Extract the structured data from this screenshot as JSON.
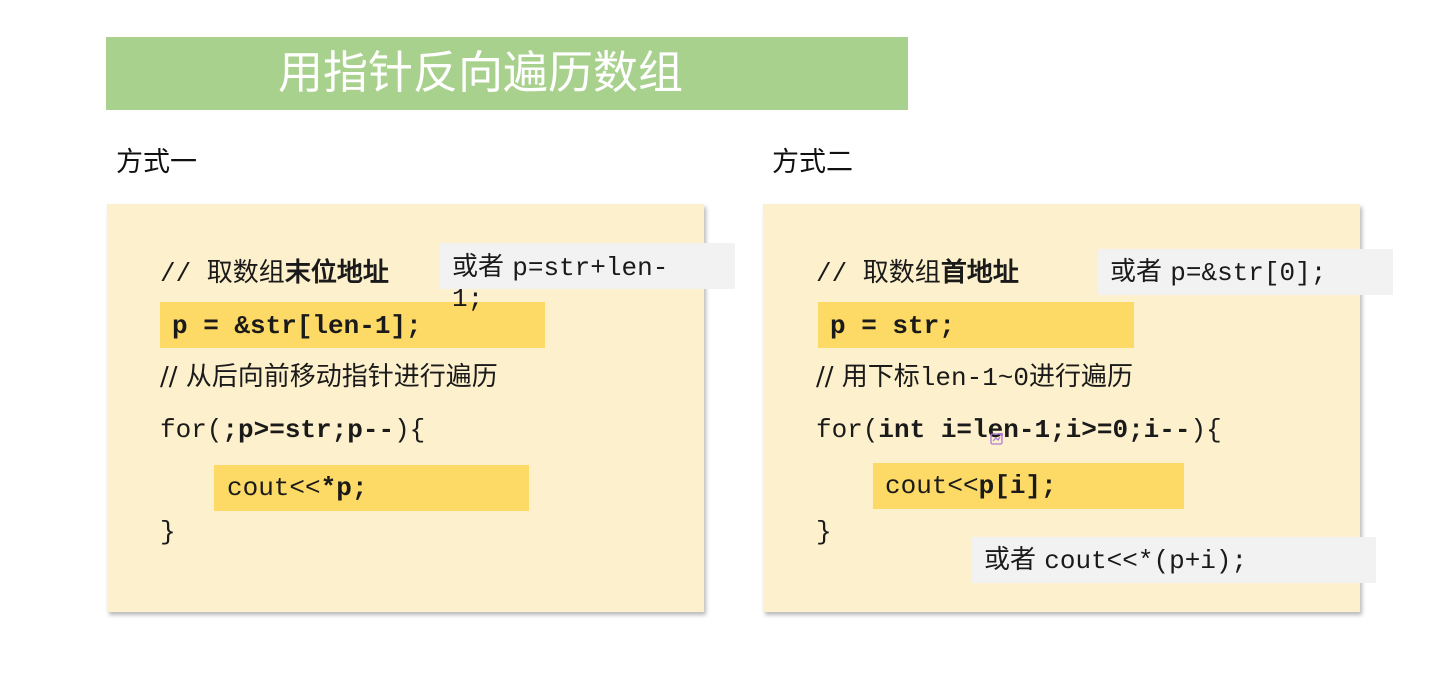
{
  "title": "用指针反向遍历数组",
  "method1": {
    "label": "方式一",
    "comment1_prefix": "// 取数组",
    "comment1_bold": "末位地址",
    "note_prefix": "或者 ",
    "note_code_1": "p=str+len-",
    "note_code_2": "1;",
    "assign": "p = &str[len-1];",
    "comment2": "// 从后向前移动指针进行遍历",
    "for_open": "for(",
    "for_cond": ";p>=str;p--",
    "for_close": "){",
    "cout_prefix": "cout<<",
    "cout_expr": "*p;",
    "close_brace": "}"
  },
  "method2": {
    "label": "方式二",
    "comment1_prefix": "// 取数组",
    "comment1_bold": "首地址",
    "note_prefix": "或者 ",
    "note_code": "p=&str[0];",
    "assign": "p = str;",
    "comment2_prefix": "// 用下标",
    "comment2_code": "len-1~0",
    "comment2_suffix": "进行遍历",
    "for_open": "for(",
    "for_cond": "int i=len-1;i>=0;i--",
    "for_close": "){",
    "cout_prefix": "cout<<",
    "cout_expr": "p[i];",
    "close_brace": "}",
    "note2_prefix": "或者 ",
    "note2_code": "cout<<*(p+i);"
  },
  "colors": {
    "title_bg": "#a9d18e",
    "panel_bg": "#fdf0cc",
    "highlight": "#fdd965",
    "note_bg": "#f2f2f2"
  },
  "icons": [
    "edit-icon"
  ]
}
